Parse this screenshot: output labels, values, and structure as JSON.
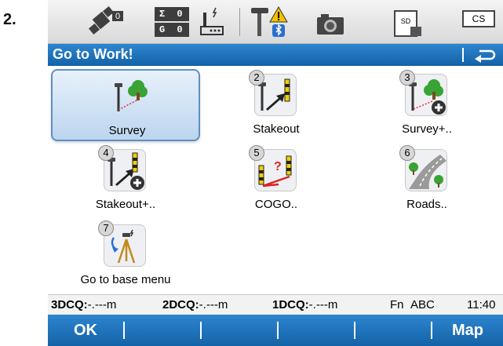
{
  "step_number": "2.",
  "status_bar": {
    "satellite_count": "0",
    "sigma_count": "0",
    "glonass_count": "0",
    "sd_label": "SD",
    "cs_label": "CS"
  },
  "title_bar": {
    "title": "Go to Work!"
  },
  "apps": [
    {
      "label": "Survey",
      "number": "",
      "selected": true,
      "icon": "survey-icon"
    },
    {
      "label": "Stakeout",
      "number": "2",
      "selected": false,
      "icon": "stakeout-icon"
    },
    {
      "label": "Survey+..",
      "number": "3",
      "selected": false,
      "icon": "survey-plus-icon"
    },
    {
      "label": "Stakeout+..",
      "number": "4",
      "selected": false,
      "icon": "stakeout-plus-icon"
    },
    {
      "label": "COGO..",
      "number": "5",
      "selected": false,
      "icon": "cogo-icon"
    },
    {
      "label": "Roads..",
      "number": "6",
      "selected": false,
      "icon": "roads-icon"
    },
    {
      "label": "Go to base menu",
      "number": "7",
      "selected": false,
      "icon": "base-menu-icon"
    }
  ],
  "info_bar": {
    "dcq3_label": "3DCQ:",
    "dcq3_value": "-.---m",
    "dcq2_label": "2DCQ:",
    "dcq2_value": "-.---m",
    "dcq1_label": "1DCQ:",
    "dcq1_value": "-.---m",
    "fn_label": "Fn",
    "input_mode": "ABC",
    "time": "11:40"
  },
  "softkeys": {
    "ok": "OK",
    "map": "Map"
  },
  "colors": {
    "title_blue": "#1f74bd",
    "selection_border": "#5f8fc4",
    "stake_yellow": "#f0d000",
    "tree_green": "#3aa335"
  }
}
